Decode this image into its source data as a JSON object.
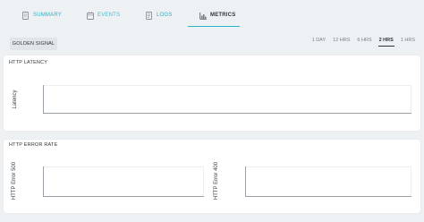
{
  "tabs": [
    {
      "label": "SUMMARY",
      "icon": "summary-document-icon",
      "state": "link"
    },
    {
      "label": "EVENTS",
      "icon": "calendar-icon",
      "state": "inactive"
    },
    {
      "label": "LOGS",
      "icon": "logs-file-icon",
      "state": "link"
    },
    {
      "label": "METRICS",
      "icon": "bar-chart-icon",
      "state": "active"
    }
  ],
  "controls": {
    "golden_signal_label": "GOLDEN SIGNAL",
    "time_ranges": [
      "1 DAY",
      "12 HRS",
      "6 HRS",
      "2 HRS",
      "1 HRS"
    ],
    "active_range": "2 HRS"
  },
  "panels": {
    "latency": {
      "title": "HTTP LATENCY",
      "ylabel": "Latency"
    },
    "error_rate": {
      "title": "HTTP ERROR RATE",
      "ylabel_500": "HTTP Error 500",
      "ylabel_400": "HTTP Error 400"
    }
  },
  "colors": {
    "accent": "#27b3c9",
    "background": "#eef1f4",
    "panel": "#ffffff"
  }
}
